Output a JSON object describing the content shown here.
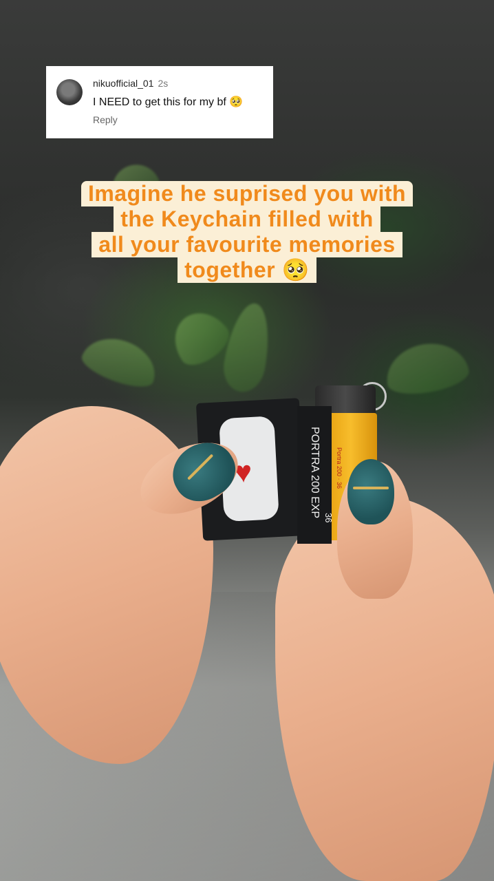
{
  "comment": {
    "username": "nikuofficial_01",
    "time": "2s",
    "text": "I NEED to get this for my bf 🥺",
    "reply_label": "Reply"
  },
  "caption": {
    "lines": [
      "Imagine he suprised you with",
      "the Keychain filled with",
      "all your favourite memories",
      "together 🥺"
    ]
  },
  "keychain": {
    "film_name": "PORTRA 200 EXP",
    "film_count": "36",
    "canister_small_text": "Portra 200 · 36"
  },
  "colors": {
    "caption_text": "#f08a1c",
    "caption_bg": "#fbefd6",
    "nail": "#1f5358",
    "canister": "#f7bd2c"
  }
}
